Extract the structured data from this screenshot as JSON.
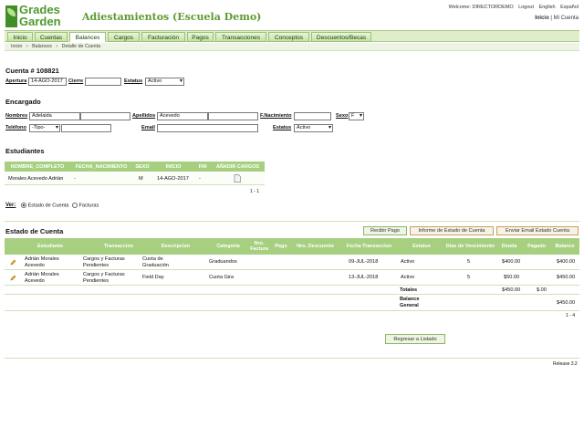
{
  "logo": {
    "line1": "Grades",
    "line2": "Garden"
  },
  "app_title": "Adiestamientos (Escuela Demo)",
  "toplinks": {
    "welcome": "Welcome: DIRECTORDEMO",
    "logout": "Logout",
    "english": "English",
    "espanol": "Español"
  },
  "sublinks": {
    "inicio": "Inicio",
    "sep": "|",
    "mi_cuenta": "Mi Cuenta"
  },
  "nav": [
    "Inicio",
    "Cuentas",
    "Balances",
    "Cargos",
    "Facturación",
    "Pagos",
    "Transacciones",
    "Conceptos",
    "Descuentos/Becas"
  ],
  "nav_active": "Balances",
  "breadcrumb": {
    "a": "Inicio",
    "b": "Balances",
    "c": "Detalle de Cuenta",
    "sep": "›"
  },
  "cuenta": {
    "title": "Cuenta # 108821",
    "apertura_label": "Apertura",
    "apertura": "14-AGO-2017",
    "cierre_label": "Cierre",
    "cierre": "",
    "estatus_label": "Estatus",
    "estatus": "Activo"
  },
  "encargado": {
    "title": "Encargado",
    "nombres_label": "Nombres",
    "nombres": "Adelaida",
    "nombres2": "",
    "apellidos_label": "Apellidos",
    "apellidos": "Acevedo",
    "apellidos2": "",
    "nacimiento_label": "F.Nacimiento",
    "nacimiento": "",
    "sexo_label": "Sexo",
    "sexo": "F",
    "telefono_label": "Teléfono",
    "telefono_tipo": "-Tipo-",
    "telefono": "",
    "email_label": "Email",
    "email": "",
    "estatus_label": "Estatus",
    "estatus": "Activo"
  },
  "estudiantes": {
    "title": "Estudiantes",
    "headers": [
      "NOMBRE_COMPLETO",
      "FECHA_NACIMIENTO",
      "SEXO",
      "INICIO",
      "FIN",
      "AÑADIR CARGOS"
    ],
    "rows": [
      [
        "Morales Acevedo Adrián",
        "-",
        "M",
        "14-AGO-2017",
        "-"
      ]
    ],
    "pager": "1 - 1"
  },
  "ver": {
    "label": "Ver:",
    "opt1": "Estado de Cuenta",
    "opt2": "Facturas"
  },
  "estado": {
    "title": "Estado de Cuenta",
    "btn_recibir": "Recibir Pago",
    "btn_informe": "Informe de Estado de Cuenta",
    "btn_email": "Enviar Email Estado Cuenta",
    "headers": [
      "Estudiante",
      "Transaccion",
      "Descripcion",
      "Categoria",
      "Nro. Factura",
      "Pago",
      "Nro. Descuento",
      "Fecha Transaccion",
      "Estatus",
      "Dias de Vencimiento",
      "Deuda",
      "Pagado",
      "Balance"
    ],
    "rows": [
      {
        "estudiante": "Adrián Morales Acevedo",
        "transaccion": "Cargos y Facturas Pendientes",
        "descripcion": "Cuota de Graduación",
        "categoria": "Graduandos",
        "fecha": "09-JUL-2018",
        "estatus": "Activo",
        "dias": "5",
        "deuda": "$400.00",
        "pagado": "",
        "balance": "$400.00"
      },
      {
        "estudiante": "Adrián Morales Acevedo",
        "transaccion": "Cargos y Facturas Pendientes",
        "descripcion": "Field Day",
        "categoria": "Cuota Gira",
        "fecha": "13-JUL-2018",
        "estatus": "Activo",
        "dias": "5",
        "deuda": "$50.00",
        "pagado": "",
        "balance": "$450.00"
      }
    ],
    "totales_label": "Totales",
    "totales_deuda": "$450.00",
    "totales_pagado": "$.00",
    "balance_label": "Balance General",
    "balance_general": "$450.00",
    "pager": "1 - 4"
  },
  "regresar": "Regresar a Listado",
  "release": "Release 3.2"
}
